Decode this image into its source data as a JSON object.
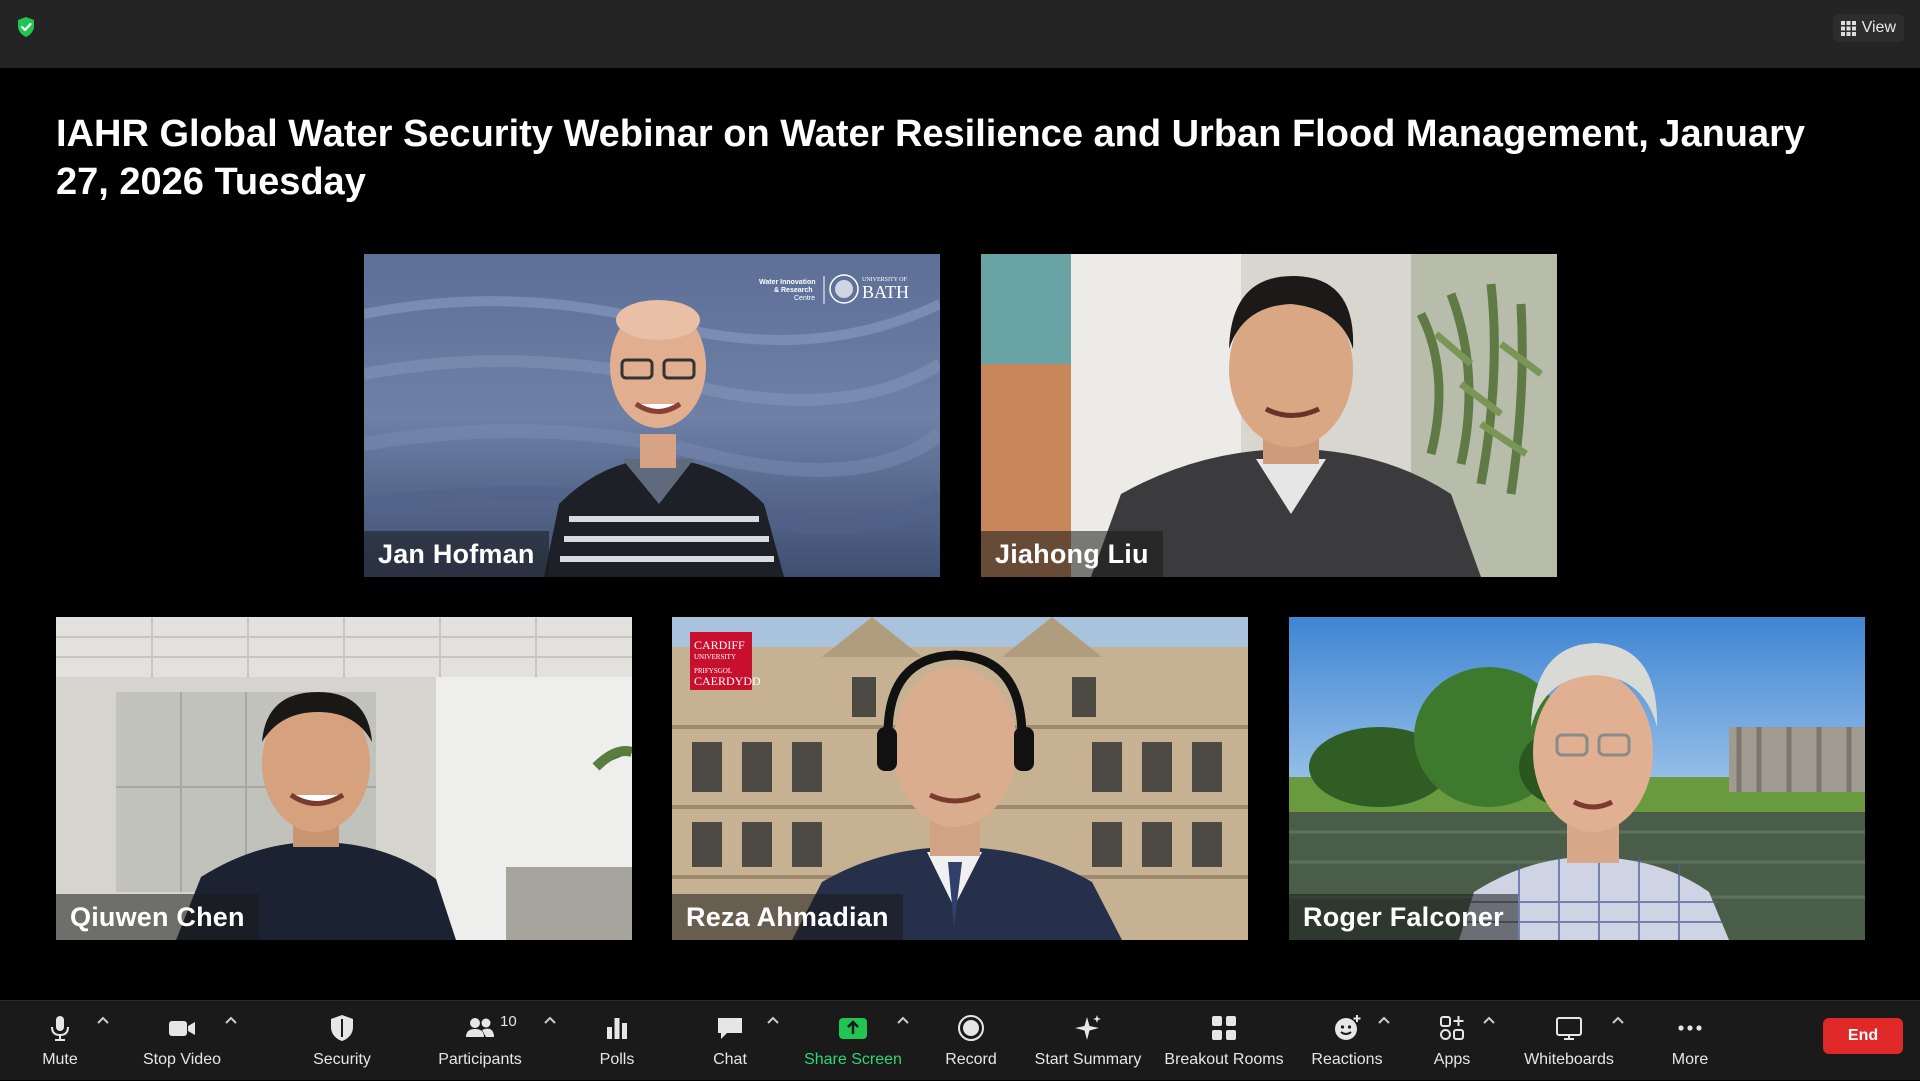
{
  "topbar": {
    "view_label": "View"
  },
  "meeting": {
    "title": "IAHR Global Water Security Webinar on Water Resilience and Urban Flood Management, January 27, 2026 Tuesday"
  },
  "participants": [
    {
      "name": "Jan Hofman",
      "background_logo": "Water Innovation & Research Centre | UNIVERSITY OF BATH"
    },
    {
      "name": "Jiahong Liu"
    },
    {
      "name": "Qiuwen Chen"
    },
    {
      "name": "Reza Ahmadian",
      "background_logo": "CARDIFF UNIVERSITY PRIFYSGOL CAERDYDD"
    },
    {
      "name": "Roger Falconer"
    }
  ],
  "toolbar": {
    "mute": "Mute",
    "stop_video": "Stop Video",
    "security": "Security",
    "participants": "Participants",
    "participants_count": "10",
    "polls": "Polls",
    "chat": "Chat",
    "share_screen": "Share Screen",
    "record": "Record",
    "start_summary": "Start Summary",
    "breakout_rooms": "Breakout Rooms",
    "reactions": "Reactions",
    "apps": "Apps",
    "whiteboards": "Whiteboards",
    "more": "More",
    "end": "End"
  },
  "colors": {
    "accent_green": "#2ed573",
    "end_red": "#e02828",
    "toolbar_bg": "#1a1a1a",
    "topbar_bg": "#242424"
  },
  "icons": {
    "encryption": "shield-check-icon",
    "view": "grid-icon",
    "mute": "microphone-icon",
    "video": "video-camera-icon",
    "security": "shield-icon",
    "participants": "people-icon",
    "polls": "bar-chart-icon",
    "chat": "chat-bubble-icon",
    "share": "share-arrow-icon",
    "record": "record-icon",
    "summary": "sparkle-icon",
    "breakout": "grid-squares-icon",
    "reactions": "smiley-plus-icon",
    "apps": "apps-icon",
    "whiteboards": "whiteboard-icon",
    "more": "ellipsis-icon"
  }
}
